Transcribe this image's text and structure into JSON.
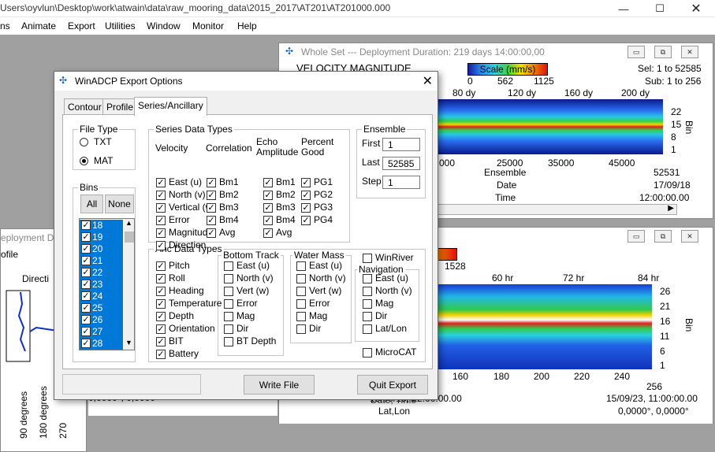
{
  "app": {
    "title": "Users\\oyvlun\\Desktop\\work\\atwain\\data\\raw_mooring_data\\2015_2017\\AT201\\AT201000.000",
    "menu": [
      "ns",
      "Animate",
      "Export",
      "Utilities",
      "Window",
      "Monitor",
      "Help"
    ]
  },
  "whole_set": {
    "title": "Whole Set --- Deployment Duration: 219 days 14:00:00,00",
    "plot_label": "VELOCITY MAGNITUDE",
    "scale_label": "Scale (mm/s)",
    "scale_ticks": [
      "0",
      "562",
      "1125"
    ],
    "sel": "Sel: 1 to 52585",
    "sub": "Sub: 1 to 256",
    "top_ticks": [
      "80 dy",
      "120 dy",
      "160 dy",
      "200 dy"
    ],
    "bin_ticks": [
      "22",
      "15",
      "8",
      "1"
    ],
    "bin_axis": "Bin",
    "bottom_ticks": [
      "000",
      "25000",
      "35000",
      "45000"
    ],
    "ens_label": "Ensemble",
    "ens_value": "52531",
    "date_label": "Date",
    "date_value": "17/09/18",
    "time_label": "Time",
    "time_value": "12:00:00.00"
  },
  "second": {
    "top_ticks": [
      "60 hr",
      "72 hr",
      "84 hr"
    ],
    "bin_ticks": [
      "26",
      "21",
      "16",
      "11",
      "6",
      "1"
    ],
    "bin_axis": "Bin",
    "scale_end": "1528",
    "bottom_ticks": [
      "160",
      "180",
      "200",
      "220",
      "240"
    ],
    "bottom_end": "256",
    "left_date": "15/09/15, 22:00:00.00",
    "mid_label": "Date, Time",
    "right_date": "15/09/23, 11:00:00.00",
    "latlon_label": "Lat,Lon",
    "left_ll": "0,0000°, 0,0000°",
    "right_ll": "0,0000°, 0,0000°"
  },
  "left_win": {
    "title": "eployment Du",
    "tab": "ofile",
    "direction": "Directi",
    "deg90": "90 degrees",
    "deg180": "180 degrees",
    "deg270": "270"
  },
  "dialog": {
    "title": "WinADCP Export Options",
    "tabs": [
      "Contour",
      "Profile",
      "Series/Ancillary"
    ],
    "file_type": {
      "label": "File Type",
      "txt": "TXT",
      "mat": "MAT",
      "selected": "MAT"
    },
    "bins": {
      "label": "Bins",
      "all": "All",
      "none": "None",
      "items": [
        "18",
        "19",
        "20",
        "21",
        "22",
        "23",
        "24",
        "25",
        "26",
        "27",
        "28"
      ]
    },
    "series": {
      "label": "Series Data Types",
      "velocity": {
        "header": "Velocity",
        "items": [
          "East (u)",
          "North (v)",
          "Vertical (w)",
          "Error",
          "Magnitude",
          "Direction"
        ]
      },
      "correlation": {
        "header": "Correlation",
        "items": [
          "Bm1",
          "Bm2",
          "Bm3",
          "Bm4",
          "Avg"
        ]
      },
      "echo": {
        "header1": "Echo",
        "header2": "Amplitude",
        "items": [
          "Bm1",
          "Bm2",
          "Bm3",
          "Bm4",
          "Avg"
        ]
      },
      "pg": {
        "header1": "Percent",
        "header2": "Good",
        "items": [
          "PG1",
          "PG2",
          "PG3",
          "PG4"
        ]
      }
    },
    "ensemble": {
      "label": "Ensemble",
      "first_label": "First",
      "first": "1",
      "last_label": "Last",
      "last": "52585",
      "step_label": "Step",
      "step": "1"
    },
    "anc": {
      "label": "Anc Data Types",
      "items": [
        "Pitch",
        "Roll",
        "Heading",
        "Temperature",
        "Depth",
        "Orientation",
        "BIT",
        "Battery"
      ]
    },
    "bottom_track": {
      "label": "Bottom Track",
      "items": [
        "East (u)",
        "North (v)",
        "Vert (w)",
        "Error",
        "Mag",
        "Dir",
        "BT Depth"
      ]
    },
    "water_mass": {
      "label": "Water Mass",
      "items": [
        "East (u)",
        "North (v)",
        "Vert (w)",
        "Error",
        "Mag",
        "Dir"
      ]
    },
    "winriver": "WinRiver",
    "navigation": {
      "label": "Navigation",
      "items": [
        "East (u)",
        "North (v)",
        "Mag",
        "Dir",
        "Lat/Lon"
      ]
    },
    "microcat": "MicroCAT",
    "write_file": "Write File",
    "quit_export": "Quit Export"
  }
}
